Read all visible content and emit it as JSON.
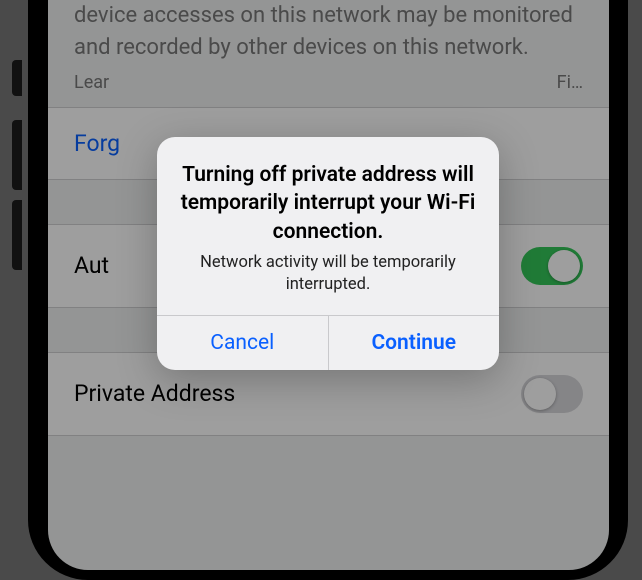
{
  "background": {
    "warning_text": "The names of websites and other servers your device accesses on this network may be monitored and recorded by other devices on this network.",
    "learn_left": "Lear",
    "learn_right": "Fi…",
    "forget_label": "Forg",
    "auto_join_label": "Aut",
    "private_address_label": "Private Address"
  },
  "switches": {
    "auto_join": true,
    "private_address": false
  },
  "alert": {
    "title": "Turning off private address will temporarily interrupt your Wi-Fi connection.",
    "message": "Network activity will be temporarily interrupted.",
    "cancel_label": "Cancel",
    "continue_label": "Continue"
  },
  "colors": {
    "accent": "#0a60ff",
    "switch_on": "#34c759",
    "bg": "#eef0f0"
  }
}
